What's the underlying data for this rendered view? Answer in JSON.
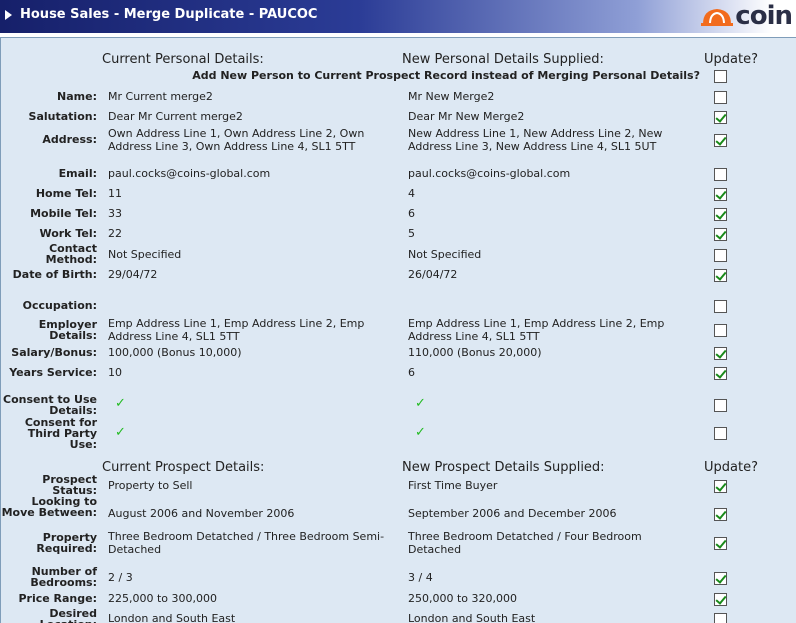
{
  "window": {
    "title": "House Sales - Merge Duplicate - PAUCOC",
    "logo_text": "coin"
  },
  "personal": {
    "current_header": "Current Personal Details:",
    "new_header": "New Personal Details Supplied:",
    "update_header": "Update?",
    "add_new_label": "Add New Person to Current Prospect Record instead of Merging Personal Details?",
    "add_new_checked": false,
    "rows": [
      {
        "label": "Name:",
        "current": "Mr Current merge2",
        "new": "Mr New Merge2",
        "checked": false
      },
      {
        "label": "Salutation:",
        "current": "Dear Mr Current merge2",
        "new": "Dear Mr New Merge2",
        "checked": true
      },
      {
        "label": "Address:",
        "current": "Own Address Line 1, Own Address Line 2, Own Address Line 3, Own Address Line 4, SL1 5TT",
        "new": "New Address Line 1, New Address Line 2, New Address Line 3, New Address Line 4, SL1 5UT",
        "checked": true
      },
      {
        "label": "Email:",
        "current": "paul.cocks@coins-global.com",
        "new": "paul.cocks@coins-global.com",
        "checked": false
      },
      {
        "label": "Home Tel:",
        "current": "11",
        "new": "4",
        "checked": true
      },
      {
        "label": "Mobile Tel:",
        "current": "33",
        "new": "6",
        "checked": true
      },
      {
        "label": "Work Tel:",
        "current": "22",
        "new": "5",
        "checked": true
      },
      {
        "label": "Contact Method:",
        "current": "Not Specified",
        "new": "Not Specified",
        "checked": false
      },
      {
        "label": "Date of Birth:",
        "current": "29/04/72",
        "new": "26/04/72",
        "checked": true
      },
      {
        "label": "Occupation:",
        "current": "",
        "new": "",
        "checked": false
      },
      {
        "label": "Employer Details:",
        "current": "Emp Address Line 1, Emp Address Line 2, Emp Address Line 4, SL1 5TT",
        "new": "Emp Address Line 1, Emp Address Line 2, Emp Address Line 4, SL1 5TT",
        "checked": false
      },
      {
        "label": "Salary/Bonus:",
        "current": "100,000 (Bonus 10,000)",
        "new": "110,000 (Bonus 20,000)",
        "checked": true
      },
      {
        "label": "Years Service:",
        "current": "10",
        "new": "6",
        "checked": true
      },
      {
        "label": "Consent to Use Details:",
        "current_tick": "✓",
        "new_tick": "✓",
        "checked": false
      },
      {
        "label": "Consent for Third Party Use:",
        "current_tick": "✓",
        "new_tick": "✓",
        "checked": false
      }
    ]
  },
  "prospect": {
    "current_header": "Current Prospect Details:",
    "new_header": "New Prospect Details Supplied:",
    "update_header": "Update?",
    "rows": [
      {
        "label": "Prospect Status:",
        "current": "Property to Sell",
        "new": "First Time Buyer",
        "checked": true
      },
      {
        "label": "Looking to Move Between:",
        "current": "August 2006 and November 2006",
        "new": "September 2006 and December 2006",
        "checked": true
      },
      {
        "label": "Property Required:",
        "current": "Three Bedroom Detatched / Three Bedroom Semi-Detached",
        "new": "Three Bedroom Detatched / Four Bedroom Detached",
        "checked": true
      },
      {
        "label": "Number of Bedrooms:",
        "current": "2 / 3",
        "new": "3 / 4",
        "checked": true
      },
      {
        "label": "Price Range:",
        "current": "225,000 to 300,000",
        "new": "250,000 to 320,000",
        "checked": true
      },
      {
        "label": "Desired Location:",
        "current": "London and South East",
        "new": "London and South East",
        "checked": false
      }
    ]
  },
  "colors": {
    "title_bar_start": "#16206a",
    "content_bg": "#dde8f3",
    "tick": "#22bb22",
    "logo_orange": "#f26b1d"
  }
}
